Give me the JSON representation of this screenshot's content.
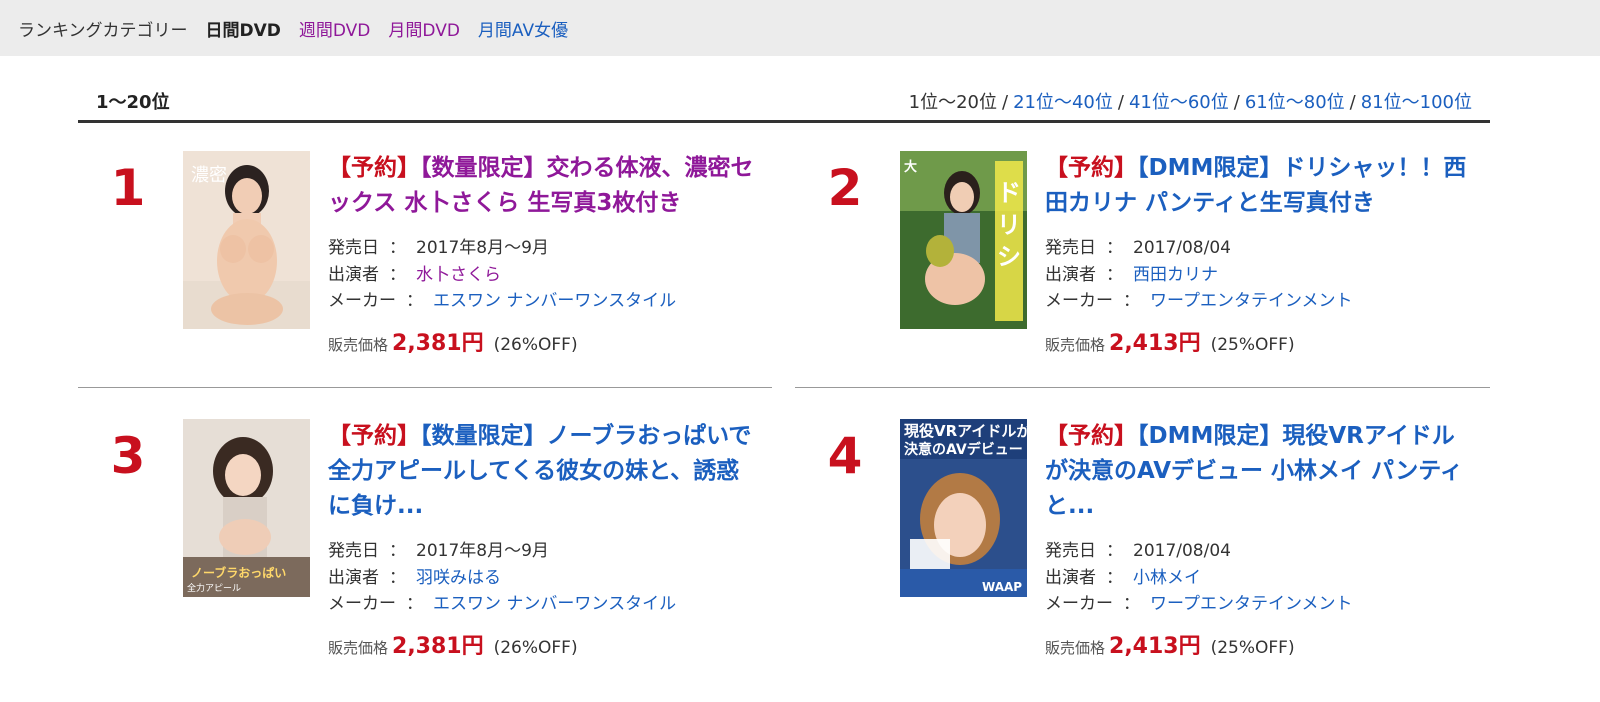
{
  "category_nav": {
    "label": "ランキングカテゴリー",
    "items": [
      {
        "label": "日間DVD"
      },
      {
        "label": "週間DVD"
      },
      {
        "label": "月間DVD"
      },
      {
        "label": "月間AV女優"
      }
    ]
  },
  "range": {
    "current": "1〜20位",
    "pages": [
      "1位〜20位",
      "21位〜40位",
      "41位〜60位",
      "61位〜80位",
      "81位〜100位"
    ]
  },
  "labels": {
    "release": "発売日",
    "performer": "出演者",
    "maker": "メーカー",
    "colon": "：",
    "price": "販売価格"
  },
  "items": [
    {
      "rank": "1",
      "prefix": "【予約】",
      "title": "【数量限定】交わる体液、濃密セックス 水卜さくら 生写真3枚付き",
      "release": "2017年8月〜9月",
      "performer": "水卜さくら",
      "maker": "エスワン ナンバーワンスタイル",
      "price": "2,381円",
      "discount": "(26%OFF)"
    },
    {
      "rank": "2",
      "prefix": "【予約】",
      "title": "【DMM限定】ドリシャッ！！西田カリナ パンティと生写真付き",
      "release": "2017/08/04",
      "performer": "西田カリナ",
      "maker": "ワープエンタテインメント",
      "price": "2,413円",
      "discount": "(25%OFF)"
    },
    {
      "rank": "3",
      "prefix": "【予約】",
      "title": "【数量限定】ノーブラおっぱいで全力アピールしてくる彼女の妹と、誘惑に負け...",
      "release": "2017年8月〜9月",
      "performer": "羽咲みはる",
      "maker": "エスワン ナンバーワンスタイル",
      "price": "2,381円",
      "discount": "(26%OFF)"
    },
    {
      "rank": "4",
      "prefix": "【予約】",
      "title": "【DMM限定】現役VRアイドルが決意のAVデビュー 小林メイ パンティと...",
      "release": "2017/08/04",
      "performer": "小林メイ",
      "maker": "ワープエンタテインメント",
      "price": "2,413円",
      "discount": "(25%OFF)"
    }
  ],
  "colors": {
    "rank": "#c8101e",
    "link": "#1b5fbf",
    "visited": "#8f1899",
    "price": "#c8101e"
  }
}
